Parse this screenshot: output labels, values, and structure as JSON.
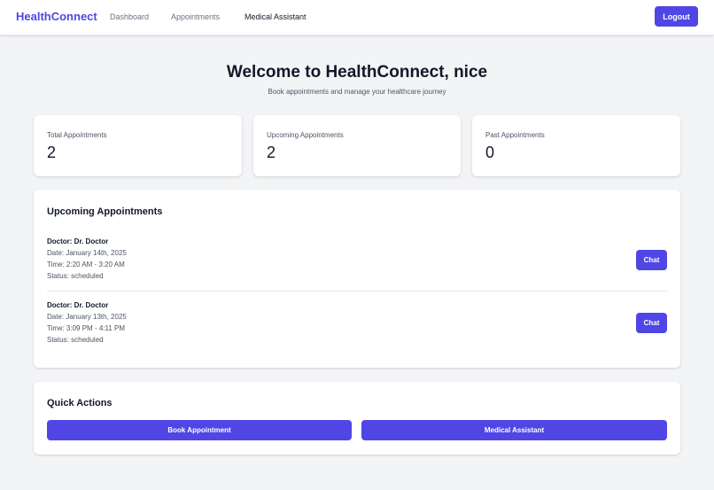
{
  "nav": {
    "brand": "HealthConnect",
    "links": [
      "Dashboard",
      "Appointments",
      "Medical Assistant"
    ],
    "logout_label": "Logout"
  },
  "header": {
    "title": "Welcome to HealthConnect, nice",
    "subtitle": "Book appointments and manage your healthcare journey"
  },
  "stats": [
    {
      "label": "Total Appointments",
      "value": "2"
    },
    {
      "label": "Upcoming Appointments",
      "value": "2"
    },
    {
      "label": "Past Appointments",
      "value": "0"
    }
  ],
  "upcoming": {
    "title": "Upcoming Appointments",
    "chat_label": "Chat",
    "items": [
      {
        "doctor": "Doctor: Dr. Doctor",
        "date": "Date: January 14th, 2025",
        "time": "Time: 2:20 AM - 3:20 AM",
        "status": "Status: scheduled"
      },
      {
        "doctor": "Doctor: Dr. Doctor",
        "date": "Date: January 13th, 2025",
        "time": "Time: 3:09 PM - 4:11 PM",
        "status": "Status: scheduled"
      }
    ]
  },
  "quick_actions": {
    "title": "Quick Actions",
    "book_label": "Book Appointment",
    "assistant_label": "Medical Assistant"
  },
  "colors": {
    "accent": "#4f46e5",
    "background": "#f3f4f6",
    "card": "#ffffff"
  }
}
